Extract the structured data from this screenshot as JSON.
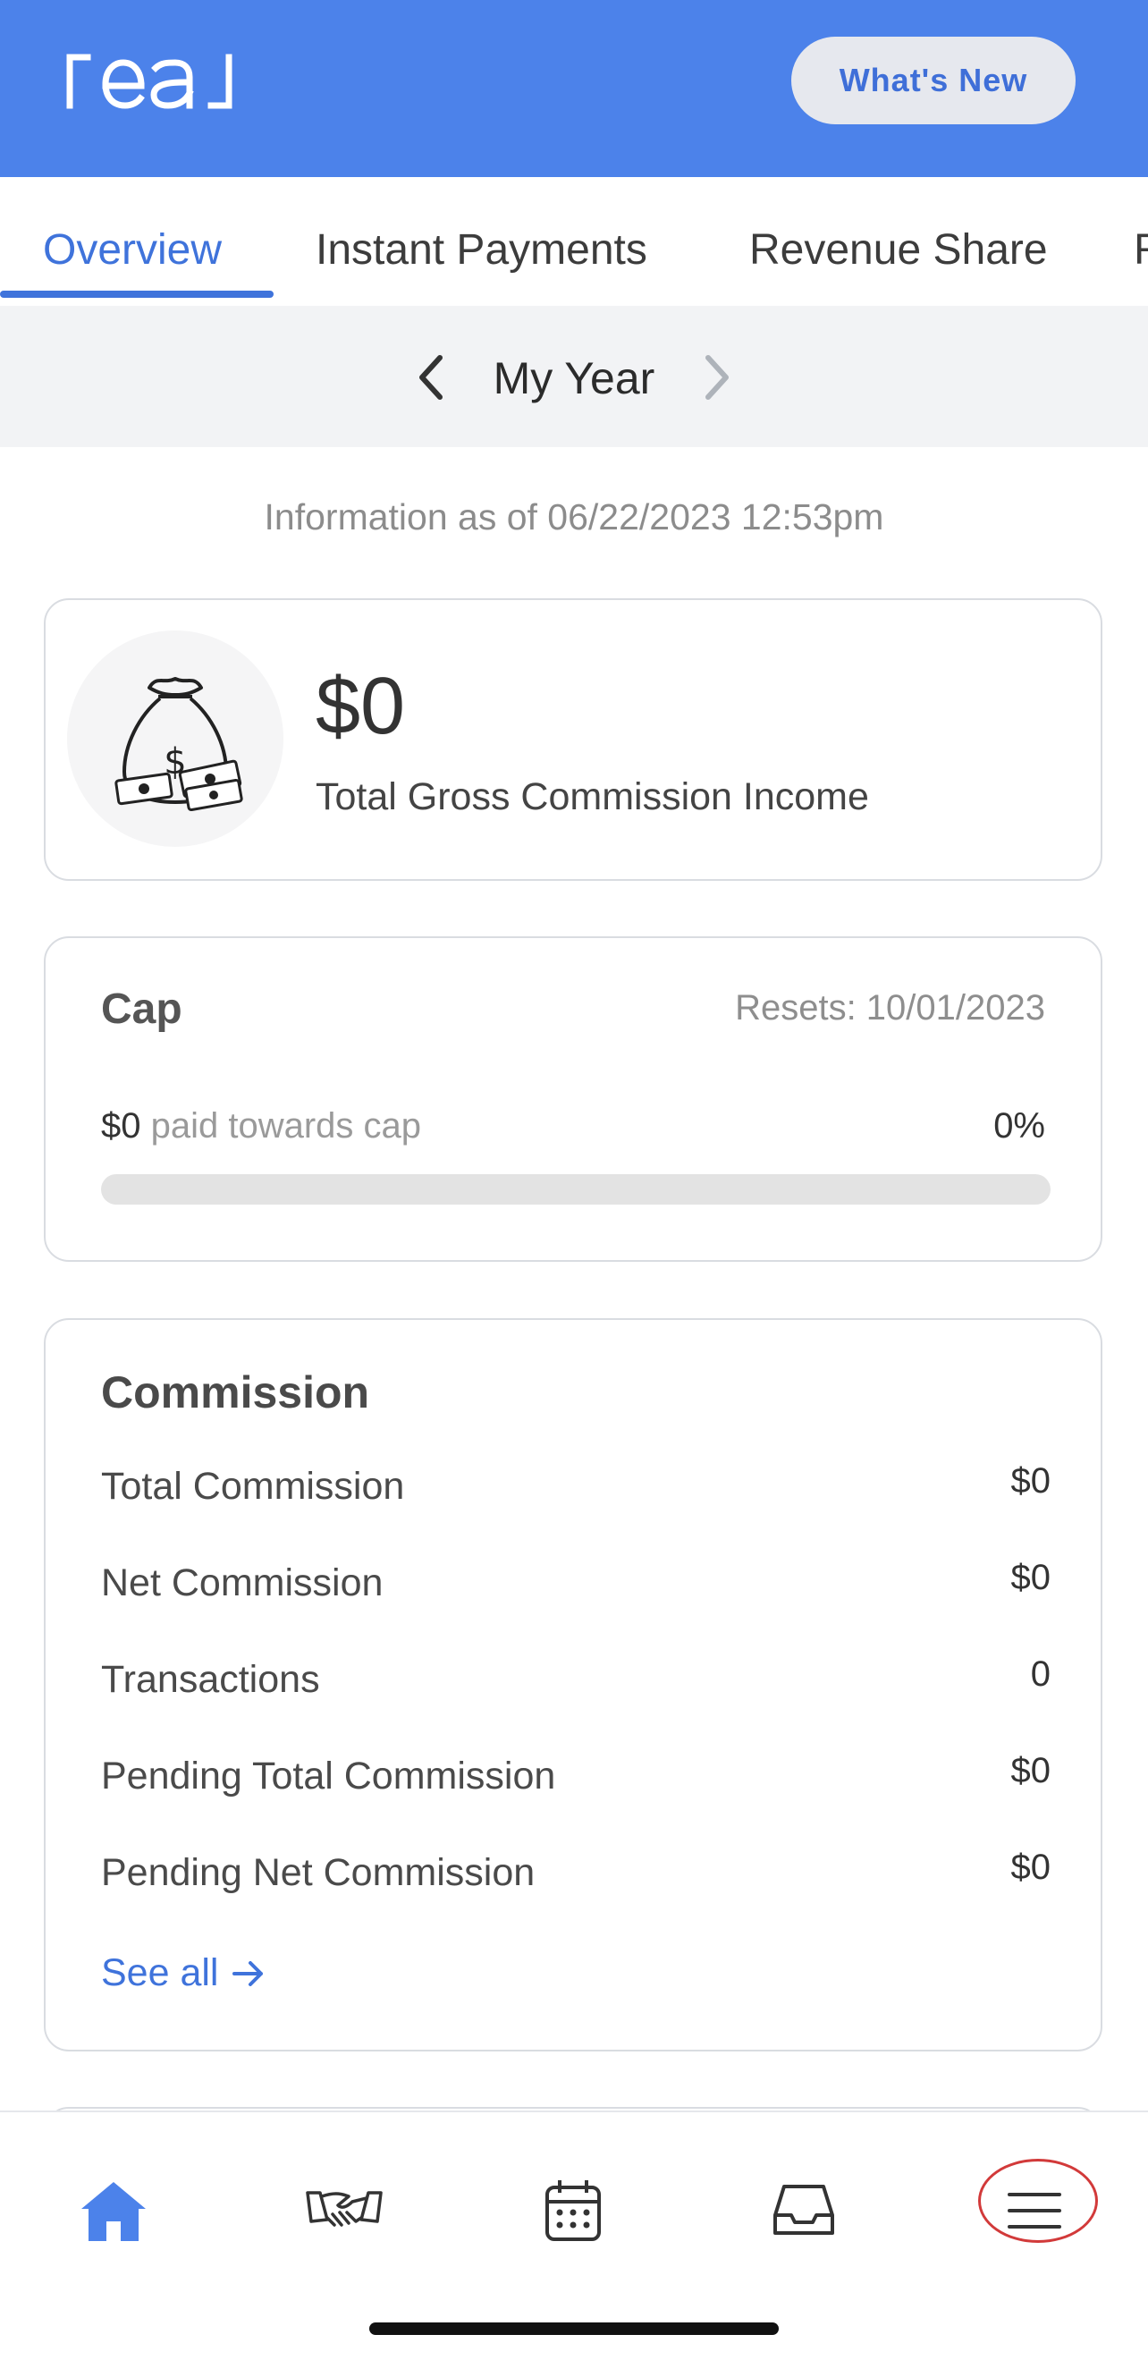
{
  "header": {
    "logo_text": "real",
    "whats_new_label": "What's New"
  },
  "tabs": [
    {
      "label": "Overview",
      "active": true
    },
    {
      "label": "Instant Payments",
      "active": false
    },
    {
      "label": "Revenue Share",
      "active": false
    },
    {
      "label": "R",
      "active": false
    }
  ],
  "period": {
    "label": "My Year"
  },
  "as_of": "Information as of 06/22/2023 12:53pm",
  "gci": {
    "amount": "$0",
    "label": "Total Gross Commission Income"
  },
  "cap": {
    "title": "Cap",
    "resets": "Resets: 10/01/2023",
    "paid_amount": "$0",
    "paid_label": " paid towards cap",
    "percent_label": "0%",
    "progress_fraction": 0
  },
  "commission": {
    "title": "Commission",
    "rows": [
      {
        "label": "Total Commission",
        "value": "$0"
      },
      {
        "label": "Net Commission",
        "value": "$0"
      },
      {
        "label": "Transactions",
        "value": "0"
      },
      {
        "label": "Pending Total Commission",
        "value": "$0"
      },
      {
        "label": "Pending Net Commission",
        "value": "$0"
      }
    ],
    "see_all": "See all"
  },
  "bottom_nav": [
    {
      "icon": "home-icon",
      "active": true
    },
    {
      "icon": "handshake-icon",
      "active": false
    },
    {
      "icon": "calendar-icon",
      "active": false
    },
    {
      "icon": "inbox-icon",
      "active": false
    },
    {
      "icon": "menu-icon",
      "active": false
    }
  ],
  "colors": {
    "brand": "#4C82EA",
    "accent": "#3F73DB",
    "highlight": "#D23A3A"
  }
}
